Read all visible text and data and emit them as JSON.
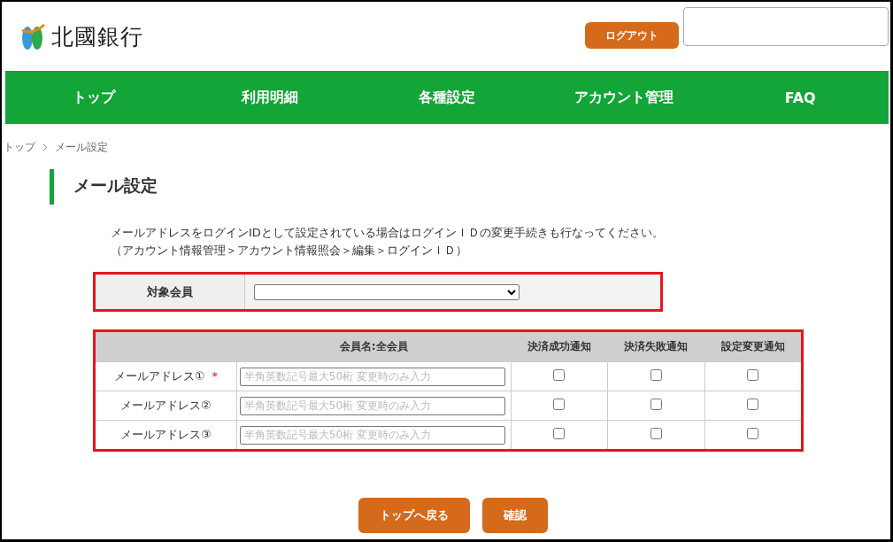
{
  "header": {
    "logo_text": "北國銀行",
    "logout": "ログアウト"
  },
  "nav": [
    "トップ",
    "利用明細",
    "各種設定",
    "アカウント管理",
    "FAQ"
  ],
  "breadcrumb": [
    "トップ",
    "メール設定"
  ],
  "page_title": "メール設定",
  "notice": [
    "メールアドレスをログインIDとして設定されている場合はログインＩＤの変更手続きも行なってください。",
    "（アカウント情報管理＞アカウント情報照会＞編集＞ログインＩＤ）"
  ],
  "target_member": {
    "label": "対象会員"
  },
  "table": {
    "columns": [
      "会員名:全会員",
      "決済成功通知",
      "決済失敗通知",
      "設定変更通知"
    ],
    "rows": [
      {
        "label": "メールアドレス①",
        "required_mark": "*",
        "placeholder": "半角英数記号最大50桁 変更時のみ入力",
        "checks": [
          false,
          false,
          false
        ]
      },
      {
        "label": "メールアドレス②",
        "placeholder": "半角英数記号最大50桁 変更時のみ入力",
        "checks": [
          false,
          false,
          false
        ]
      },
      {
        "label": "メールアドレス③",
        "placeholder": "半角英数記号最大50桁 変更時のみ入力",
        "checks": [
          false,
          false,
          false
        ]
      }
    ]
  },
  "buttons": [
    "トップへ戻る",
    "確認"
  ]
}
